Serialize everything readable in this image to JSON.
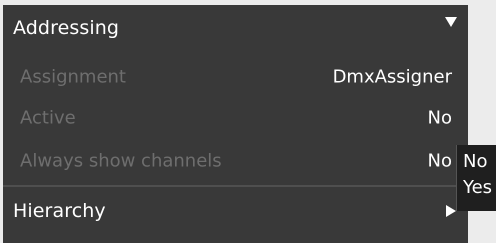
{
  "sections": {
    "addressing": {
      "title": "Addressing",
      "rows": [
        {
          "label": "Assignment",
          "value": "DmxAssigner"
        },
        {
          "label": "Active",
          "value": "No"
        },
        {
          "label": "Always show channels",
          "value": "No"
        }
      ]
    },
    "hierarchy": {
      "title": "Hierarchy"
    }
  },
  "dropdown": {
    "options": [
      "No",
      "Yes"
    ]
  },
  "icons": {
    "addressing_toggle": "chevron-down-icon",
    "hierarchy_toggle": "chevron-right-icon"
  },
  "colors": {
    "panel_bg": "#393939",
    "label_dim": "#6e6e6e",
    "text": "#ffffff",
    "dropdown_bg": "#1f1f1f"
  }
}
